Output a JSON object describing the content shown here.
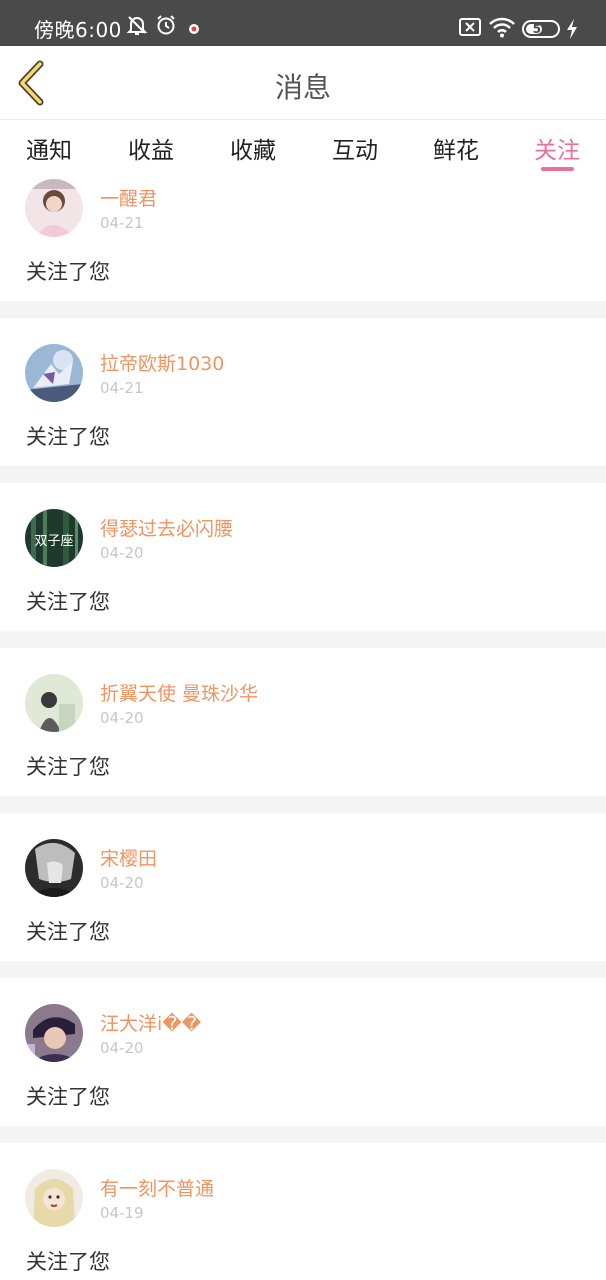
{
  "status_bar": {
    "time": "傍晚6:00",
    "battery_level": "52",
    "battery_fraction": 0.52,
    "icons": [
      "bell-off-icon",
      "alarm-icon",
      "notification-dot-icon",
      "sim-blocked-icon",
      "wifi-icon",
      "battery-icon",
      "charging-icon"
    ]
  },
  "header": {
    "back_icon": "chevron-left-icon",
    "title": "消息"
  },
  "tabs": [
    {
      "label": "通知"
    },
    {
      "label": "收益"
    },
    {
      "label": "收藏"
    },
    {
      "label": "互动"
    },
    {
      "label": "鲜花"
    },
    {
      "label": "关注",
      "active": true
    }
  ],
  "colors": {
    "accent": "#ea6fa0",
    "username": "#ef9563",
    "date": "#c7c7c7",
    "separator": "#f4f4f4"
  },
  "messages": [
    {
      "user": "一醒君",
      "date": "04-21",
      "text": "关注了您"
    },
    {
      "user": "拉帝欧斯1030",
      "date": "04-21",
      "text": "关注了您"
    },
    {
      "user": "得瑟过去必闪腰",
      "date": "04-20",
      "text": "关注了您",
      "avatar_text": "双子座"
    },
    {
      "user": "折翼天使 曼珠沙华",
      "date": "04-20",
      "text": "关注了您"
    },
    {
      "user": "宋樱田",
      "date": "04-20",
      "text": "关注了您"
    },
    {
      "user": "汪大洋i��",
      "date": "04-20",
      "text": "关注了您"
    },
    {
      "user": "有一刻不普通",
      "date": "04-19",
      "text": "关注了您"
    }
  ]
}
